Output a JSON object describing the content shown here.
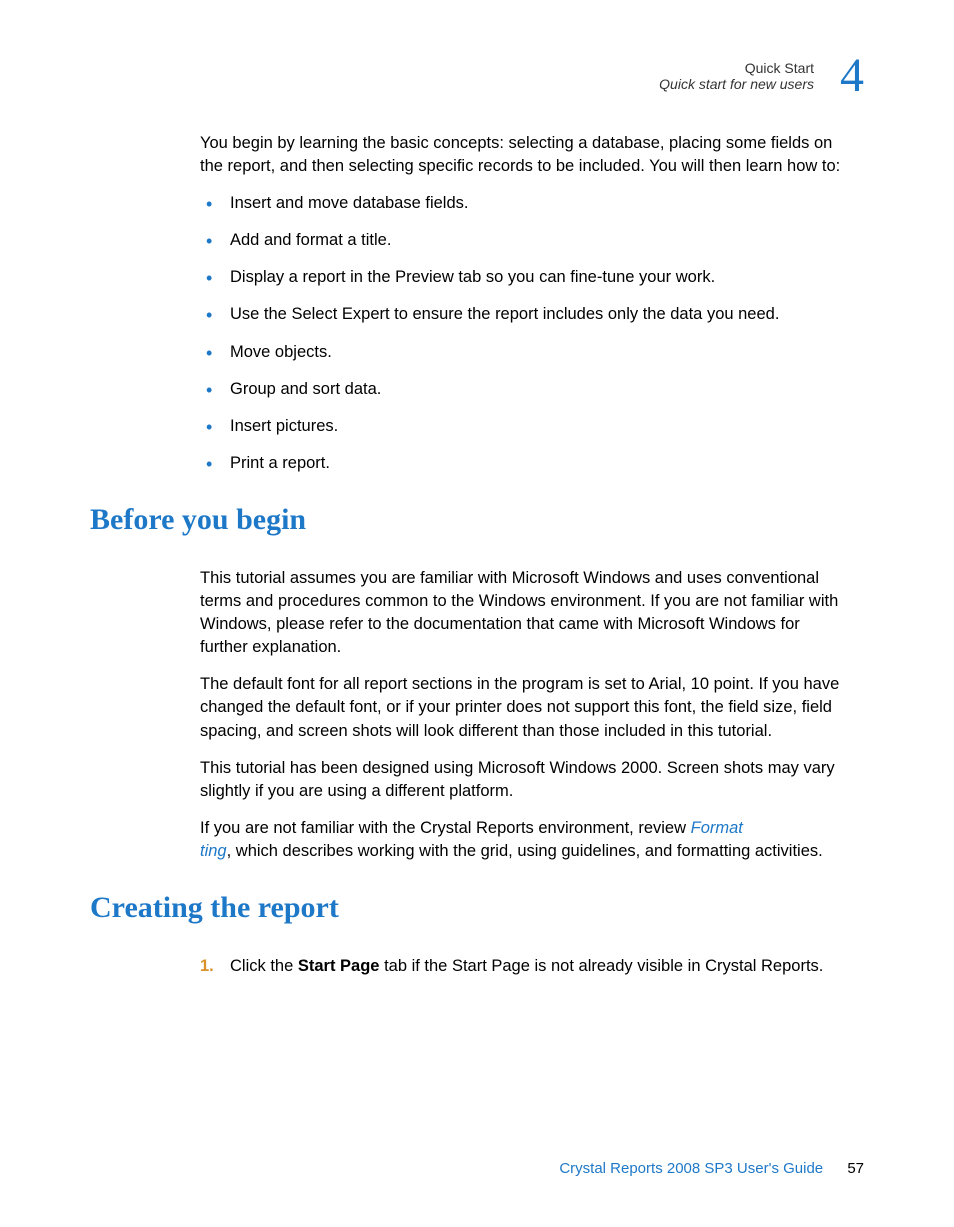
{
  "header": {
    "chapter_label": "Quick Start",
    "section_label": "Quick start for new users",
    "chapter_number": "4"
  },
  "intro": {
    "para": "You begin by learning the basic concepts: selecting a database, placing some fields on the report, and then selecting specific records to be included. You will then learn how to:",
    "bullets": [
      "Insert and move database fields.",
      "Add and format a title.",
      "Display a report in the Preview tab so you can fine-tune your work.",
      "Use the Select Expert to ensure the report includes only the data you need.",
      "Move objects.",
      "Group and sort data.",
      "Insert pictures.",
      "Print a report."
    ]
  },
  "section1": {
    "heading": "Before you begin",
    "para1": "This tutorial assumes you are familiar with Microsoft Windows and uses conventional terms and procedures common to the Windows environment. If you are not familiar with Windows, please refer to the documentation that came with Microsoft Windows for further explanation.",
    "para2": "The default font for all report sections in the program is set to Arial, 10 point. If you have changed the default font, or if your printer does not support this font, the field size, field spacing, and screen shots will look different than those included in this tutorial.",
    "para3": "This tutorial has been designed using Microsoft Windows 2000. Screen shots may vary slightly if you are using a different platform.",
    "para4_pre": "If you are not familiar with the Crystal Reports environment, review ",
    "para4_link1": "Format",
    "para4_link2": "ting",
    "para4_post": ", which describes working with the grid, using guidelines, and formatting activities."
  },
  "section2": {
    "heading": "Creating the report",
    "step1_num": "1.",
    "step1_pre": "Click the ",
    "step1_bold": "Start Page",
    "step1_post": " tab if the Start Page is not already visible in Crystal Reports."
  },
  "footer": {
    "doc_title": "Crystal Reports 2008 SP3 User's Guide",
    "page_number": "57"
  }
}
